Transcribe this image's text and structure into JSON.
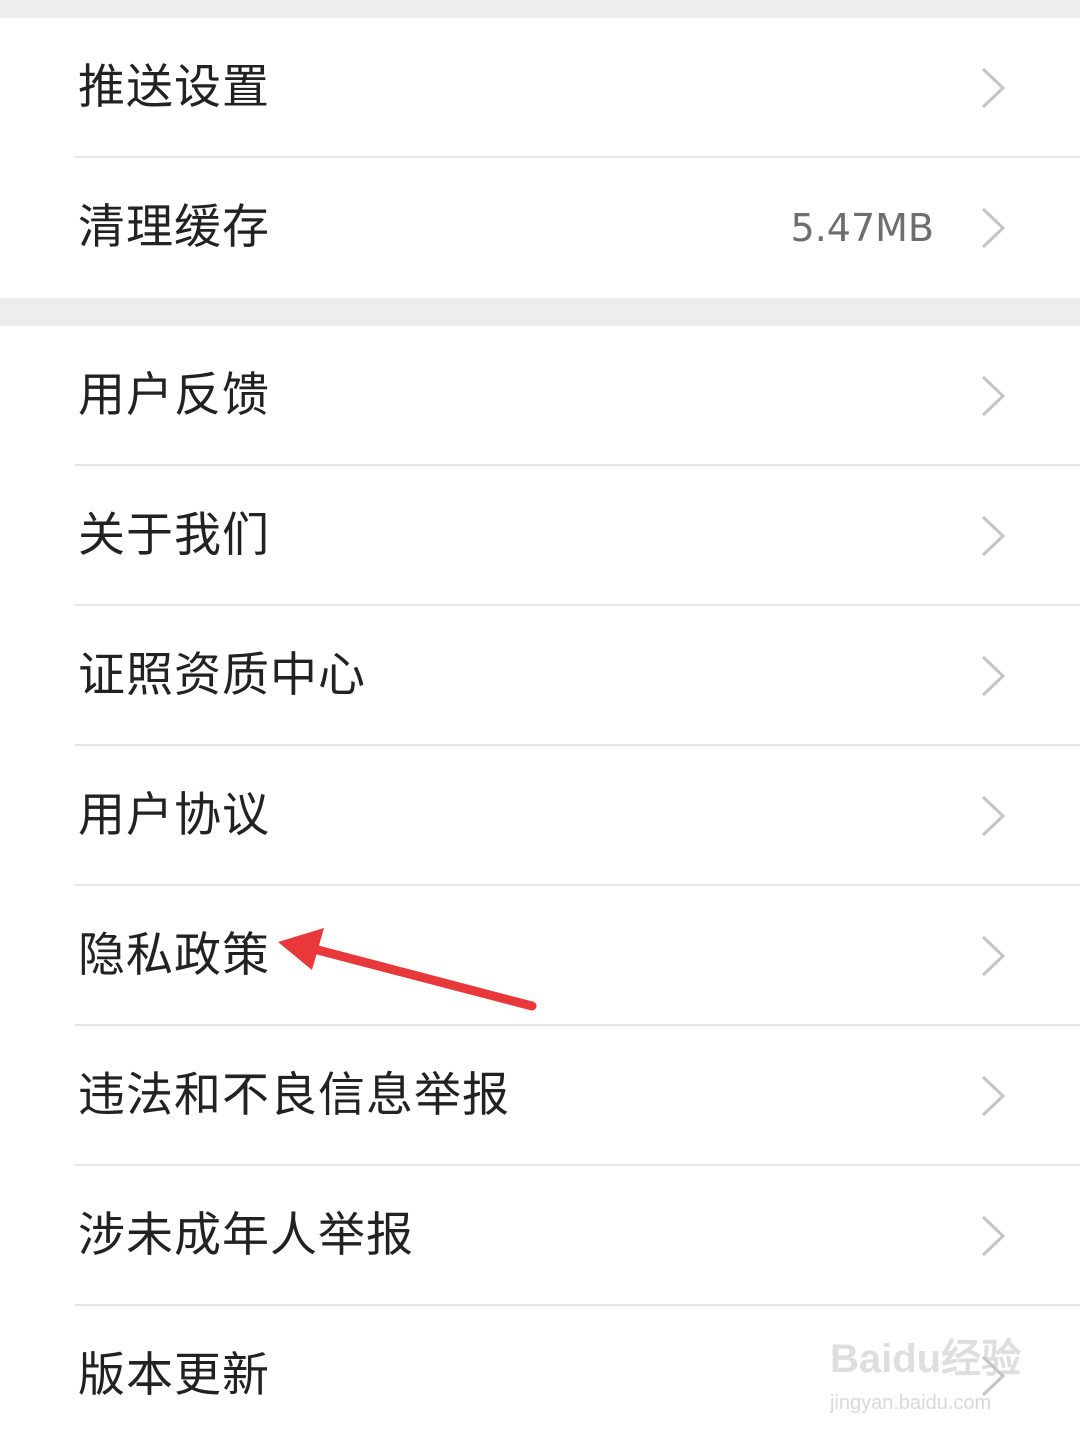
{
  "settings": {
    "group1": [
      {
        "label": "推送设置",
        "value": ""
      },
      {
        "label": "清理缓存",
        "value": "5.47MB"
      }
    ],
    "group2": [
      {
        "label": "用户反馈",
        "value": ""
      },
      {
        "label": "关于我们",
        "value": ""
      },
      {
        "label": "证照资质中心",
        "value": ""
      },
      {
        "label": "用户协议",
        "value": ""
      },
      {
        "label": "隐私政策",
        "value": ""
      },
      {
        "label": "违法和不良信息举报",
        "value": ""
      },
      {
        "label": "涉未成年人举报",
        "value": ""
      },
      {
        "label": "版本更新",
        "value": ""
      }
    ]
  },
  "annotation": {
    "arrow_color": "#e8383a",
    "target": "隐私政策"
  },
  "watermark": {
    "logo": "Baidu经验",
    "site": "jingyan.baidu.com"
  },
  "colors": {
    "background": "#ededf0",
    "row": "#ffffff",
    "text": "#222222",
    "secondary_text": "#6e6e6e",
    "chevron": "#c4c4c4"
  }
}
